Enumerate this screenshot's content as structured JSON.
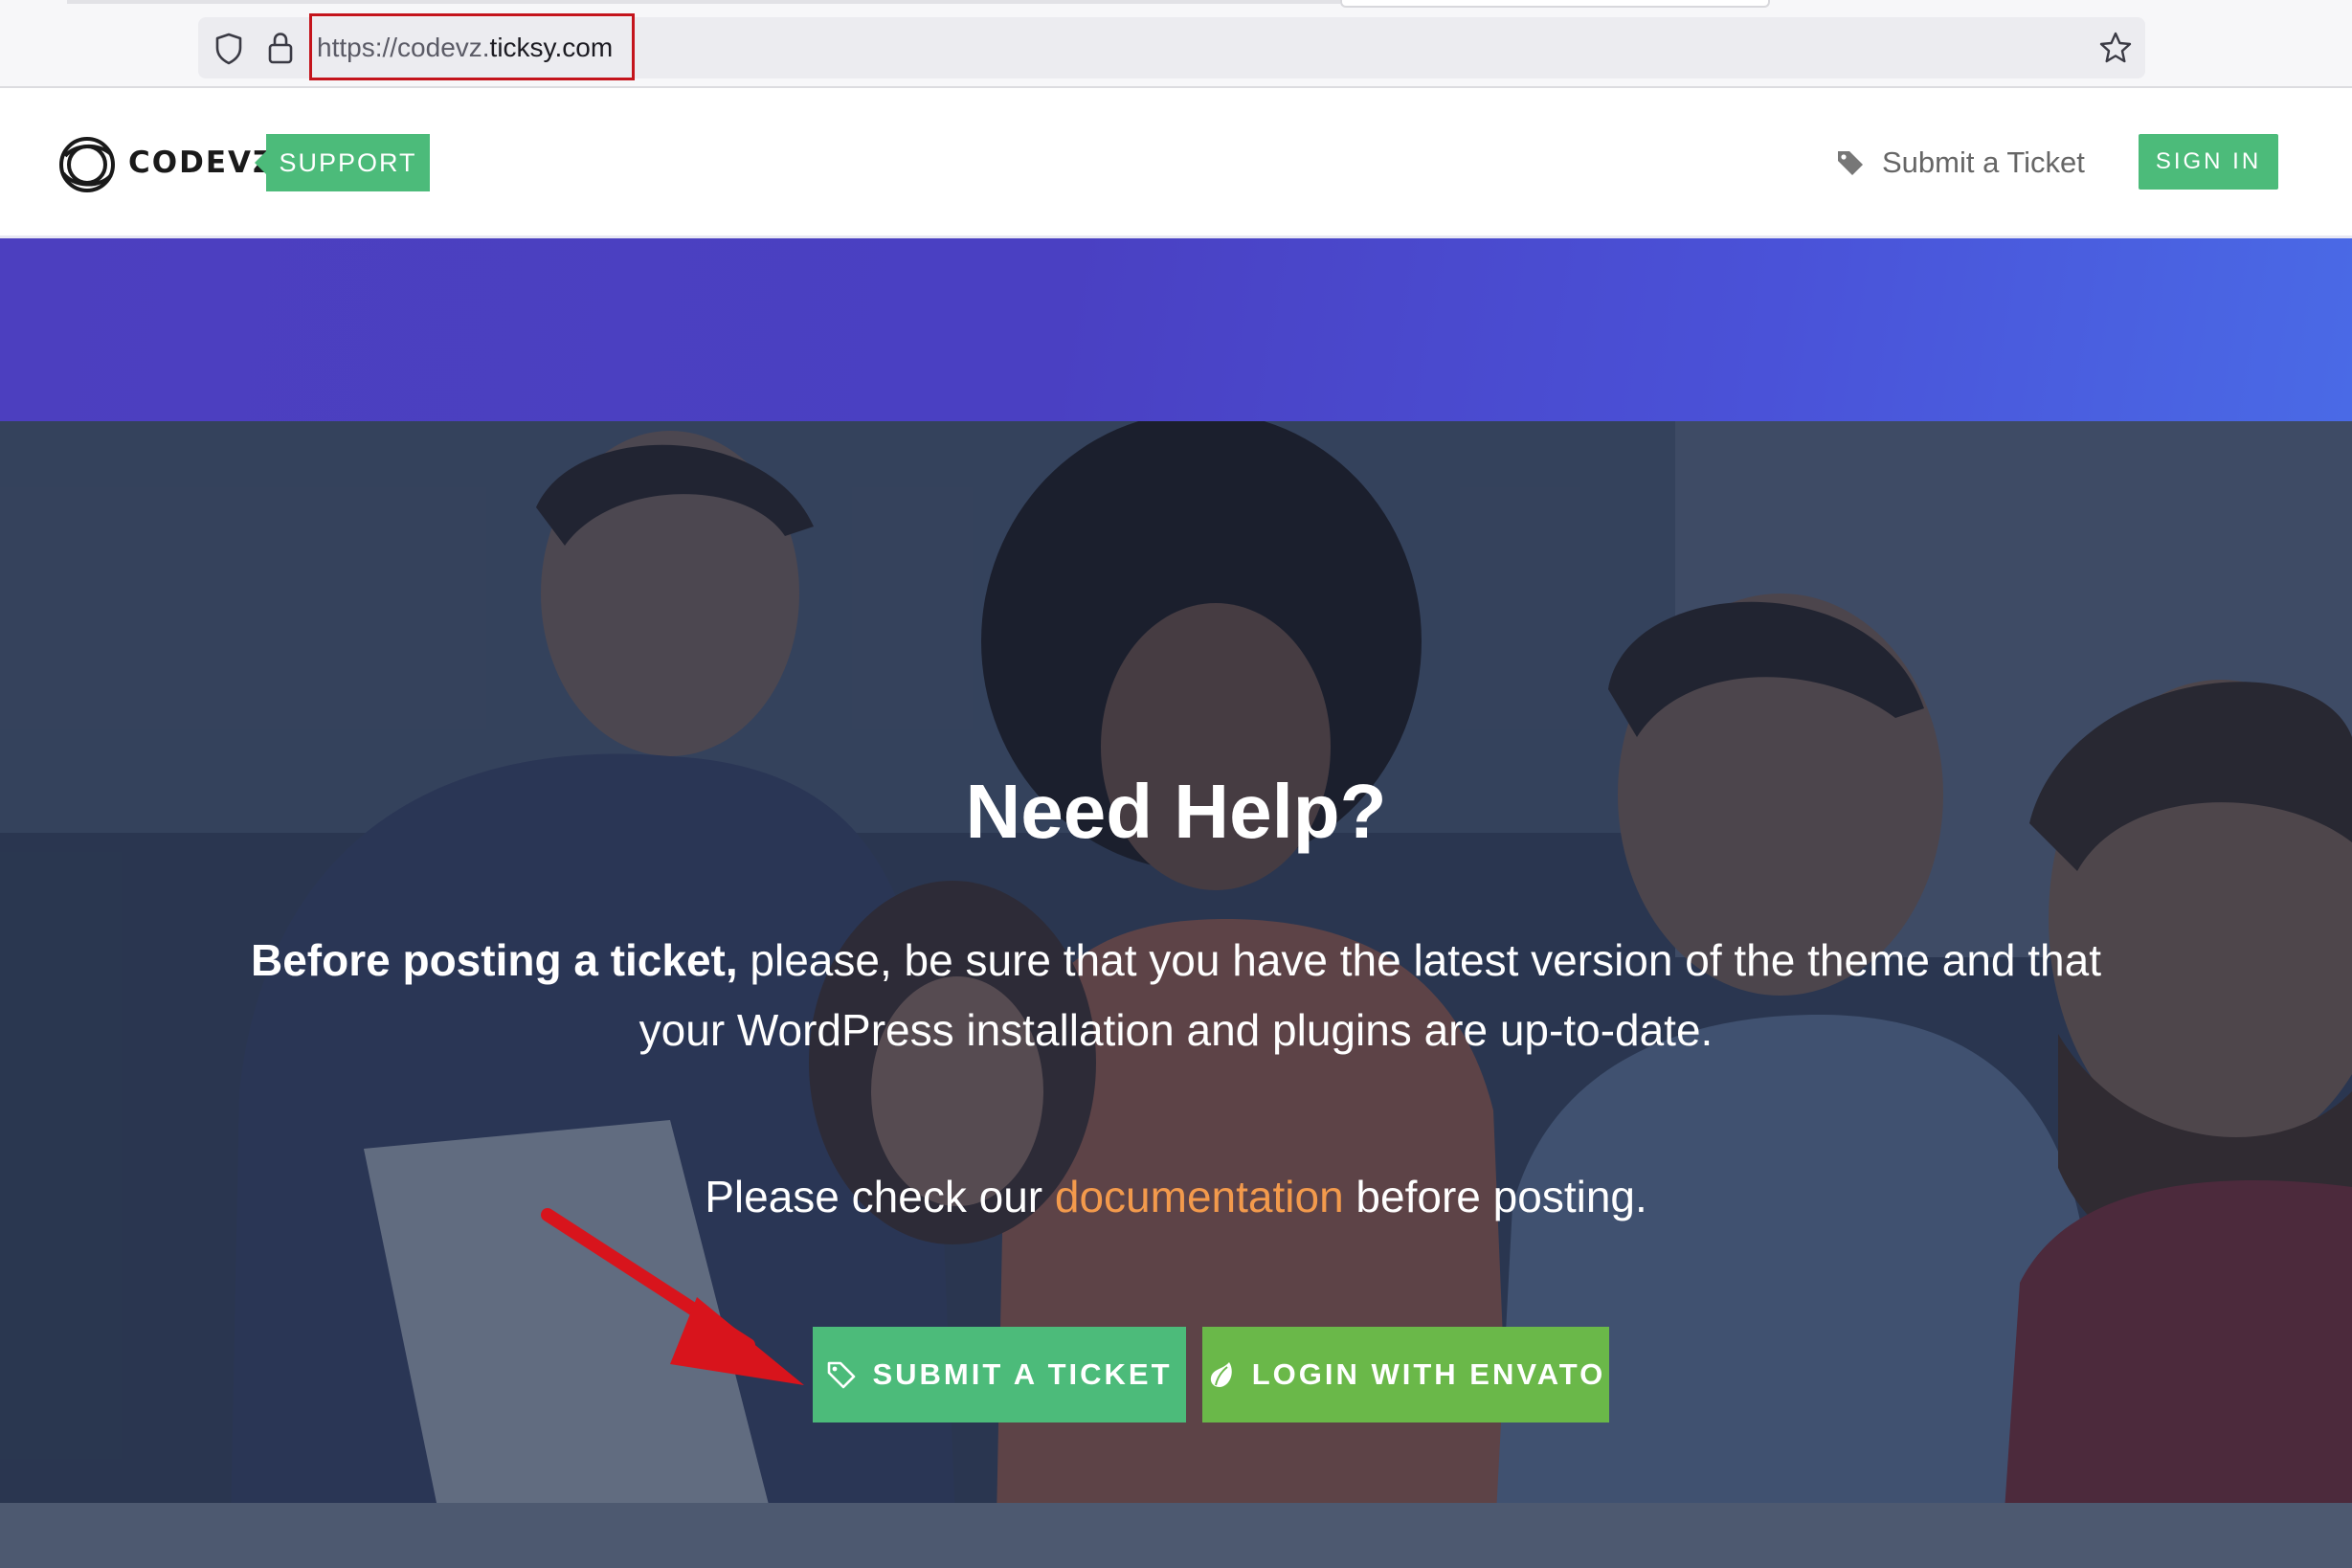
{
  "browser": {
    "url_scheme": "https://",
    "url_host_sub": "codevz.",
    "url_host_main": "ticksy.com"
  },
  "header": {
    "logo_text": "CODEVZ",
    "support_badge": "SUPPORT",
    "nav_submit_label": "Submit a Ticket",
    "signin_label": "SIGN IN"
  },
  "hero": {
    "title": "Need Help?",
    "notice_bold": "Before posting a ticket,",
    "notice_rest": " please, be sure that you have the latest version of the theme and that",
    "notice_line2": "your WordPress installation and plugins are up-to-date.",
    "doc_before": "Please check our ",
    "doc_link": "documentation",
    "doc_after": " before posting.",
    "submit_button": "SUBMIT A TICKET",
    "envato_button": "LOGIN WITH ENVATO"
  },
  "colors": {
    "accent_green": "#4cbb7a",
    "envato_green": "#6ab849",
    "band_purple": "#4c3fbf",
    "link_orange": "#f39a4c",
    "annotation_red": "#d8141c"
  },
  "icons": {
    "shield": "shield-icon",
    "lock": "lock-icon",
    "star": "bookmark-star-icon",
    "tag": "tag-icon",
    "leaf": "envato-leaf-icon",
    "arrow": "red-arrow-annotation"
  }
}
